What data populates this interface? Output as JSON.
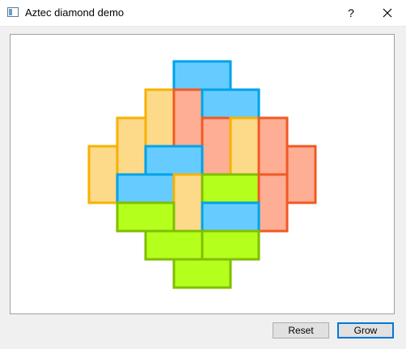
{
  "window": {
    "title": "Aztec diamond demo",
    "help_label": "?",
    "close_icon": "close-icon"
  },
  "buttons": {
    "reset_label": "Reset",
    "grow_label": "Grow"
  },
  "palette": {
    "blue": {
      "fill": "#66ccff",
      "stroke": "#00a2e8"
    },
    "yellow": {
      "fill": "#fdd98a",
      "stroke": "#f7b100"
    },
    "red": {
      "fill": "#fdae94",
      "stroke": "#ef5a24"
    },
    "green": {
      "fill": "#b5ff1c",
      "stroke": "#7fbf00"
    }
  },
  "tiling": {
    "order": 4,
    "dominoes": [
      {
        "color": "blue",
        "col": 3,
        "row": 0,
        "w": 2,
        "h": 1
      },
      {
        "color": "yellow",
        "col": 2,
        "row": 1,
        "w": 1,
        "h": 2
      },
      {
        "color": "red",
        "col": 3,
        "row": 1,
        "w": 1,
        "h": 2
      },
      {
        "color": "blue",
        "col": 4,
        "row": 1,
        "w": 2,
        "h": 1
      },
      {
        "color": "yellow",
        "col": 1,
        "row": 2,
        "w": 1,
        "h": 2
      },
      {
        "color": "red",
        "col": 4,
        "row": 2,
        "w": 1,
        "h": 2
      },
      {
        "color": "yellow",
        "col": 5,
        "row": 2,
        "w": 1,
        "h": 2
      },
      {
        "color": "red",
        "col": 6,
        "row": 2,
        "w": 1,
        "h": 2
      },
      {
        "color": "yellow",
        "col": 0,
        "row": 3,
        "w": 1,
        "h": 2
      },
      {
        "color": "blue",
        "col": 2,
        "row": 3,
        "w": 2,
        "h": 1
      },
      {
        "color": "red",
        "col": 7,
        "row": 3,
        "w": 1,
        "h": 2
      },
      {
        "color": "blue",
        "col": 1,
        "row": 4,
        "w": 2,
        "h": 1
      },
      {
        "color": "yellow",
        "col": 3,
        "row": 4,
        "w": 1,
        "h": 2
      },
      {
        "color": "green",
        "col": 4,
        "row": 4,
        "w": 2,
        "h": 1
      },
      {
        "color": "red",
        "col": 6,
        "row": 4,
        "w": 1,
        "h": 2
      },
      {
        "color": "green",
        "col": 1,
        "row": 5,
        "w": 2,
        "h": 1
      },
      {
        "color": "blue",
        "col": 4,
        "row": 5,
        "w": 2,
        "h": 1
      },
      {
        "color": "green",
        "col": 2,
        "row": 6,
        "w": 2,
        "h": 1
      },
      {
        "color": "green",
        "col": 4,
        "row": 6,
        "w": 2,
        "h": 1
      },
      {
        "color": "green",
        "col": 3,
        "row": 7,
        "w": 2,
        "h": 1
      }
    ]
  }
}
